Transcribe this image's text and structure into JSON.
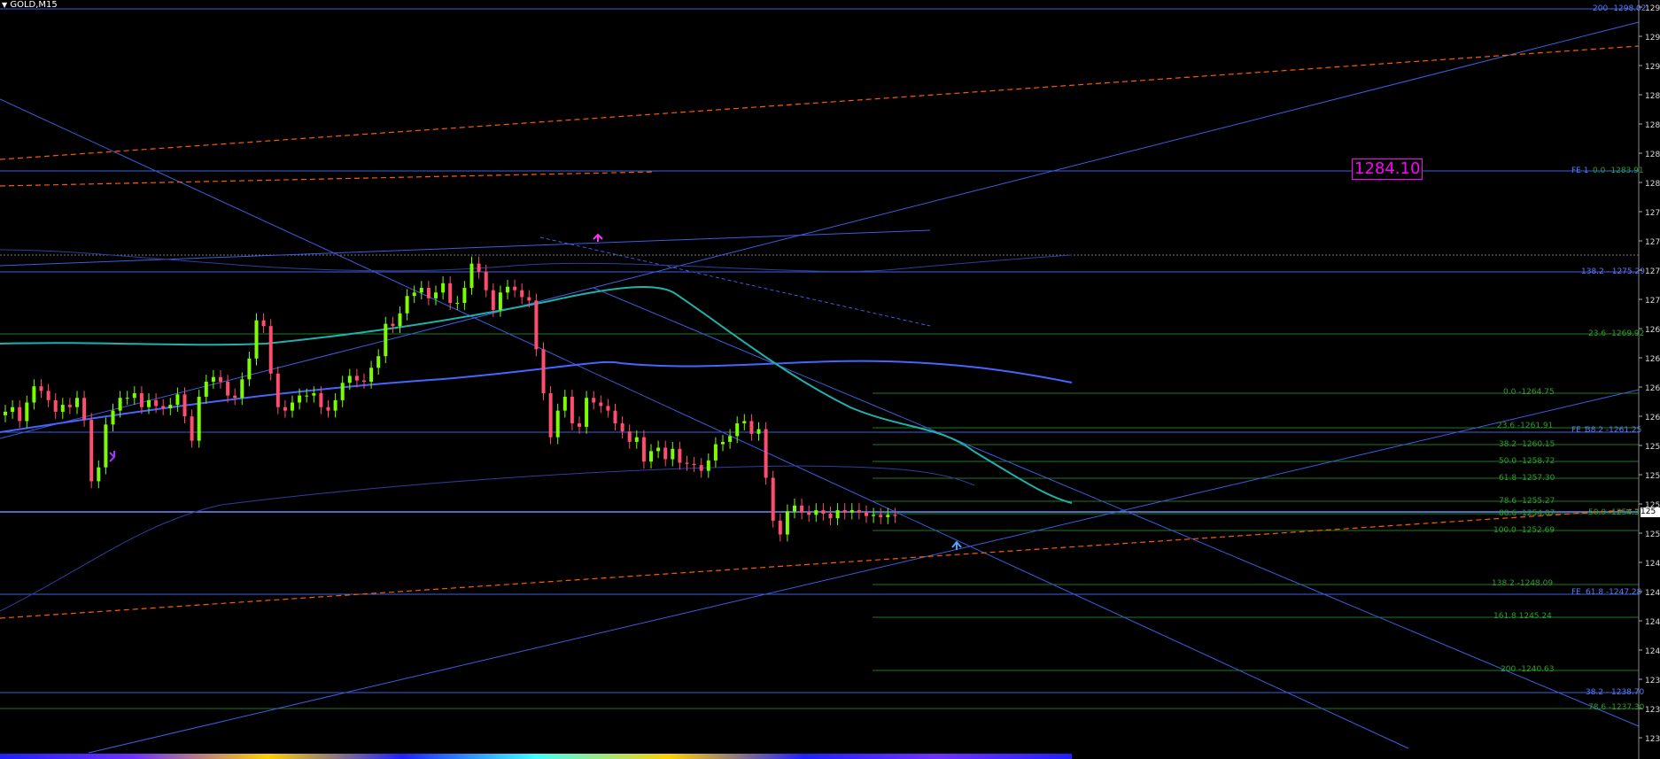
{
  "symbol_label": "GOLD,M15",
  "price_tag": "1284.10",
  "colors": {
    "background": "#000000",
    "bull": "#7CFC00",
    "bear": "#FF4D6D",
    "blue_line": "#3A5FE0",
    "green_line": "#1F7A1F",
    "orange_dash": "#FF5A00",
    "teal": "#20B2AA",
    "magenta": "#FF00FF",
    "fib_green_text": "#2E9E2E",
    "fib_blue_text": "#5A7BFF"
  },
  "right_axis_ticks": [
    "129",
    "129",
    "129",
    "128",
    "128",
    "128",
    "128",
    "127",
    "127",
    "127",
    "127",
    "126",
    "126",
    "126",
    "126",
    "125",
    "125",
    "125",
    "125",
    "124",
    "124",
    "124",
    "124",
    "123",
    "123",
    "123"
  ],
  "current_price_label": "125",
  "bottom_labels": [
    "FE 1",
    "FE 1",
    "FE"
  ],
  "fib_labels": [
    {
      "text": "200 -1298.02",
      "kind": "blue"
    },
    {
      "text": "0.0 -1283.91",
      "kind": "green"
    },
    {
      "text": "138.2 - 1275.29",
      "kind": "blue"
    },
    {
      "text": "23.6 -1269.92",
      "kind": "green"
    },
    {
      "text": "0.0 -1264.75",
      "kind": "green"
    },
    {
      "text": "23.6 -1261.91",
      "kind": "green"
    },
    {
      "text": "38.2 -1261.25",
      "kind": "blue"
    },
    {
      "text": "38.2 -1260.15",
      "kind": "green"
    },
    {
      "text": "50.0 -1258.72",
      "kind": "green"
    },
    {
      "text": "61.8 -1257.30",
      "kind": "green"
    },
    {
      "text": "78.6 -1255.27",
      "kind": "green"
    },
    {
      "text": "88.6 -1254.07",
      "kind": "green"
    },
    {
      "text": "50.0 -1254.3",
      "kind": "green"
    },
    {
      "text": "100.0 -1252.69",
      "kind": "green"
    },
    {
      "text": "138.2 -1248.09",
      "kind": "green"
    },
    {
      "text": "61.8 -1247.28",
      "kind": "blue"
    },
    {
      "text": "161.8 1245.24",
      "kind": "green"
    },
    {
      "text": "200 -1240.63",
      "kind": "green"
    },
    {
      "text": "38.2 - 1238.70",
      "kind": "blue"
    },
    {
      "text": "78.6 -1237.30",
      "kind": "green"
    }
  ],
  "chart_data": {
    "type": "candlestick",
    "title": "GOLD,M15",
    "ylim": [
      1236,
      1300
    ],
    "closes": [
      1263.3,
      1263.7,
      1262.5,
      1264.1,
      1265.5,
      1265.1,
      1264.3,
      1263.3,
      1263.9,
      1263.7,
      1264.5,
      1262.6,
      1257.3,
      1258.5,
      1262.2,
      1263.4,
      1264.5,
      1264.5,
      1264.9,
      1263.7,
      1264.3,
      1263.8,
      1263.6,
      1263.9,
      1264.8,
      1262.9,
      1260.8,
      1264.6,
      1265.9,
      1266.3,
      1265.9,
      1264.7,
      1264.5,
      1266.1,
      1267.9,
      1271.2,
      1270.7,
      1266.6,
      1263.7,
      1263.4,
      1264.1,
      1264.7,
      1264.7,
      1264.9,
      1263.7,
      1263.4,
      1264.3,
      1265.8,
      1266.4,
      1266.0,
      1265.9,
      1267.1,
      1268.1,
      1270.9,
      1270.7,
      1271.8,
      1273.3,
      1273.6,
      1274.0,
      1273.1,
      1273.6,
      1274.4,
      1272.7,
      1272.7,
      1274.0,
      1276.1,
      1275.4,
      1273.8,
      1272.1,
      1273.6,
      1274.1,
      1273.8,
      1273.2,
      1272.9,
      1268.7,
      1264.9,
      1261.1,
      1263.4,
      1264.6,
      1262.3,
      1262.0,
      1264.5,
      1264.1,
      1263.8,
      1263.4,
      1262.3,
      1261.6,
      1260.7,
      1261.1,
      1259.0,
      1259.9,
      1260.2,
      1259.2,
      1260.1,
      1258.9,
      1258.8,
      1258.7,
      1258.2,
      1259.1,
      1260.5,
      1260.7,
      1261.2,
      1262.3,
      1262.5,
      1261.4,
      1261.8,
      1257.6,
      1253.9,
      1252.7,
      1254.7,
      1255.2,
      1254.6,
      1254.4,
      1254.8,
      1254.5,
      1254.1,
      1254.8,
      1254.6,
      1254.8,
      1254.6,
      1254.3,
      1254.4,
      1254.2,
      1254.4,
      1254.3
    ]
  }
}
